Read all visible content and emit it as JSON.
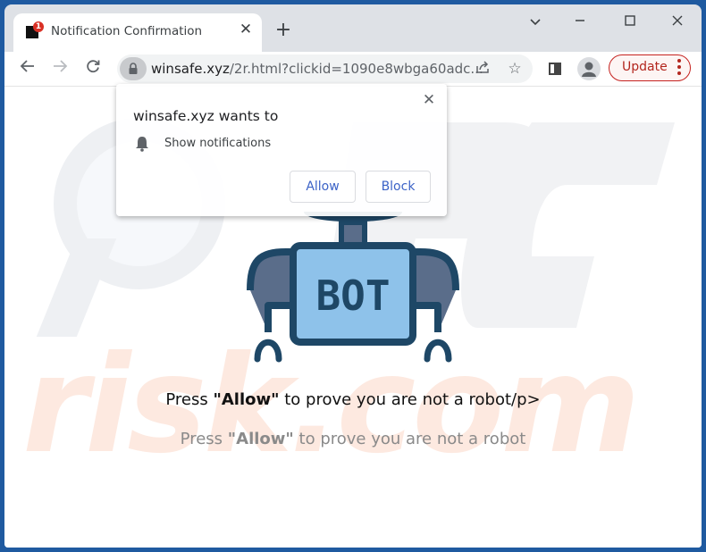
{
  "browser": {
    "tab": {
      "title": "Notification Confirmation",
      "badge": "1"
    },
    "url": {
      "host": "winsafe.xyz",
      "path": "/2r.html?clickid=1090e8wbga60adc..."
    },
    "update_button": "Update"
  },
  "permission_prompt": {
    "title": "winsafe.xyz wants to",
    "permission": "Show notifications",
    "allow_label": "Allow",
    "block_label": "Block"
  },
  "page": {
    "robot_label": "BOT",
    "message_primary": {
      "before": "Press ",
      "bold": "\"Allow\"",
      "after": " to prove you are not a robot/p>"
    },
    "message_secondary": {
      "before": "Press ",
      "bold": "\"Allow\"",
      "after": " to prove you are not a robot"
    },
    "watermark": "risk.com"
  }
}
